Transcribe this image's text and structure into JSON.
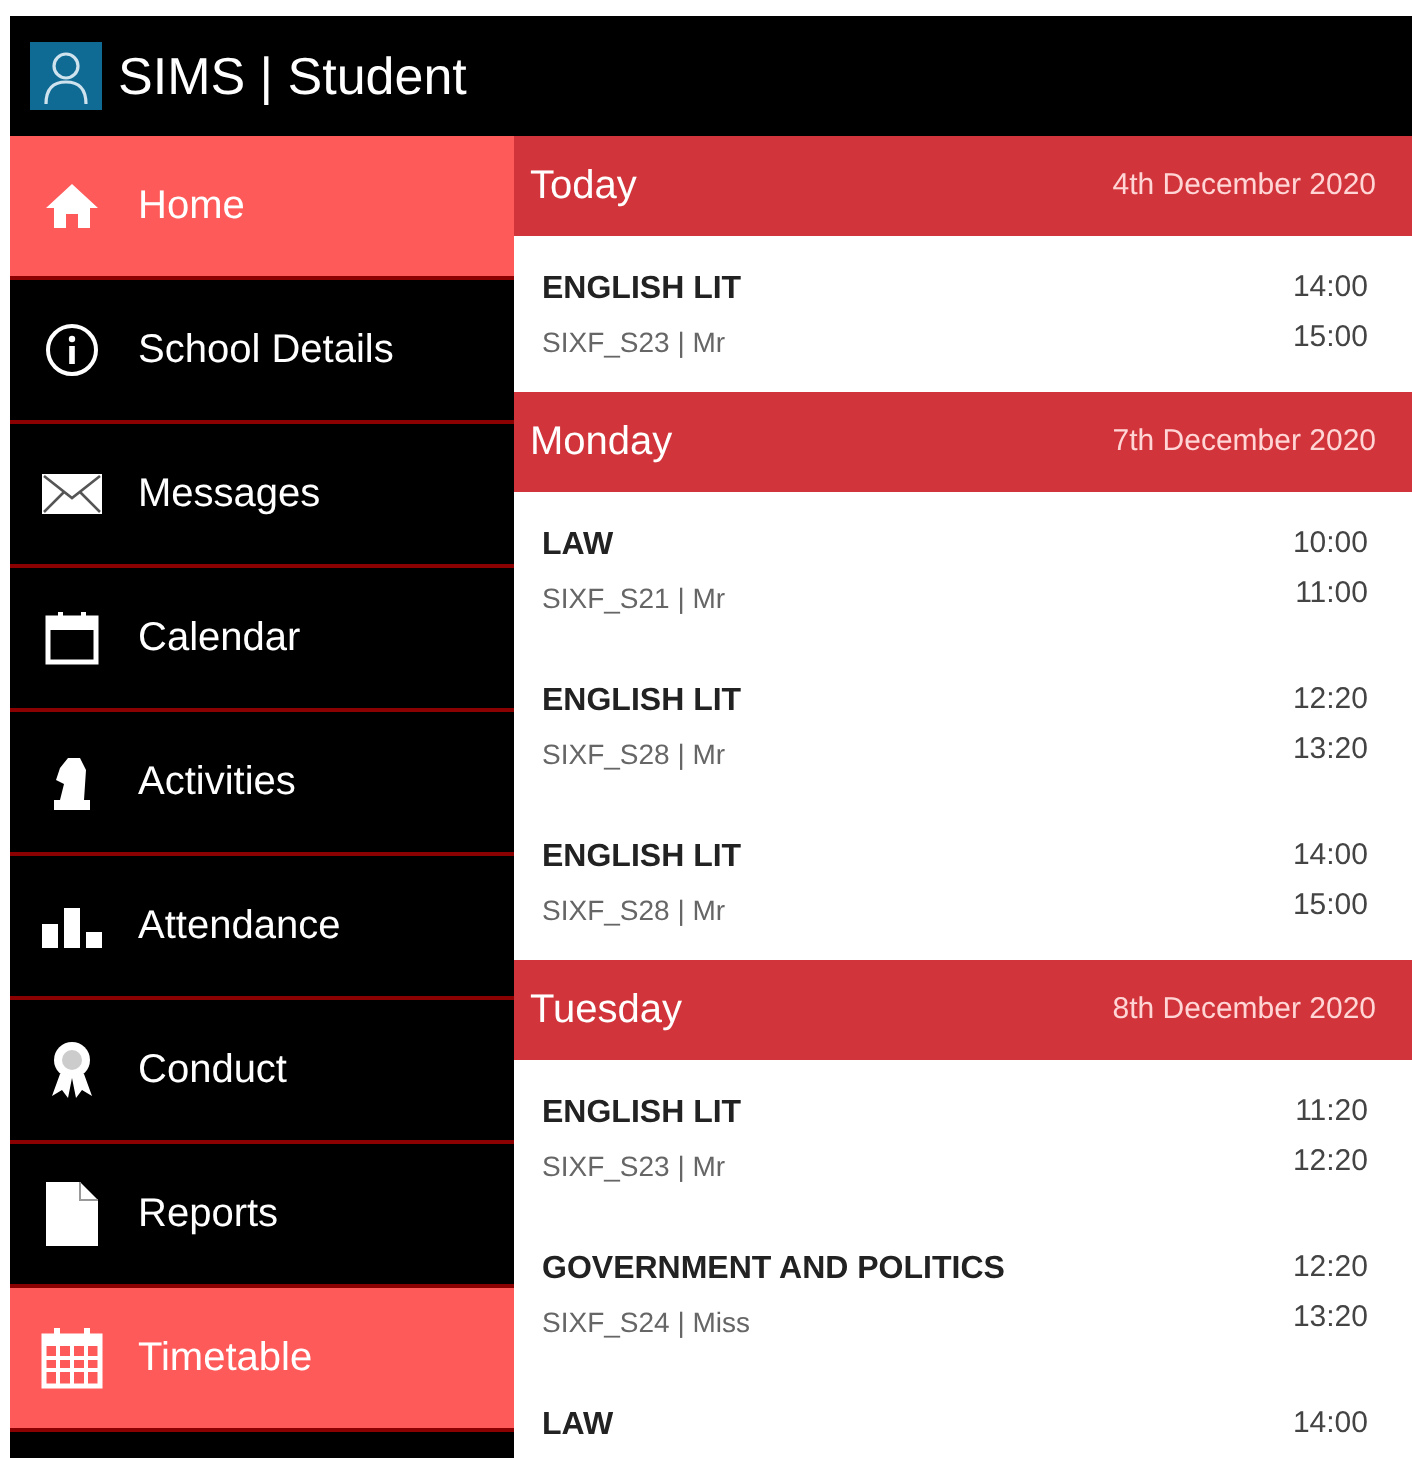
{
  "app": {
    "title": "SIMS | Student"
  },
  "sidebar": {
    "items": [
      {
        "label": "Home",
        "selected": true
      },
      {
        "label": "School Details",
        "selected": false
      },
      {
        "label": "Messages",
        "selected": false
      },
      {
        "label": "Calendar",
        "selected": false
      },
      {
        "label": "Activities",
        "selected": false
      },
      {
        "label": "Attendance",
        "selected": false
      },
      {
        "label": "Conduct",
        "selected": false
      },
      {
        "label": "Reports",
        "selected": false
      },
      {
        "label": "Timetable",
        "selected": true
      }
    ]
  },
  "days": [
    {
      "day": "Today",
      "date": "4th December 2020",
      "lessons": [
        {
          "subject": "ENGLISH LIT",
          "detail": "SIXF_S23 | Mr",
          "start": "14:00",
          "end": "15:00"
        }
      ]
    },
    {
      "day": "Monday",
      "date": "7th December 2020",
      "lessons": [
        {
          "subject": "LAW",
          "detail": "SIXF_S21 | Mr",
          "start": "10:00",
          "end": "11:00"
        },
        {
          "subject": "ENGLISH LIT",
          "detail": "SIXF_S28 | Mr",
          "start": "12:20",
          "end": "13:20"
        },
        {
          "subject": "ENGLISH LIT",
          "detail": "SIXF_S28 | Mr",
          "start": "14:00",
          "end": "15:00"
        }
      ]
    },
    {
      "day": "Tuesday",
      "date": "8th December 2020",
      "lessons": [
        {
          "subject": "ENGLISH LIT",
          "detail": "SIXF_S23 | Mr",
          "start": "11:20",
          "end": "12:20"
        },
        {
          "subject": "GOVERNMENT AND POLITICS",
          "detail": "SIXF_S24 | Miss",
          "start": "12:20",
          "end": "13:20"
        },
        {
          "subject": "LAW",
          "start": "14:00"
        }
      ]
    }
  ]
}
